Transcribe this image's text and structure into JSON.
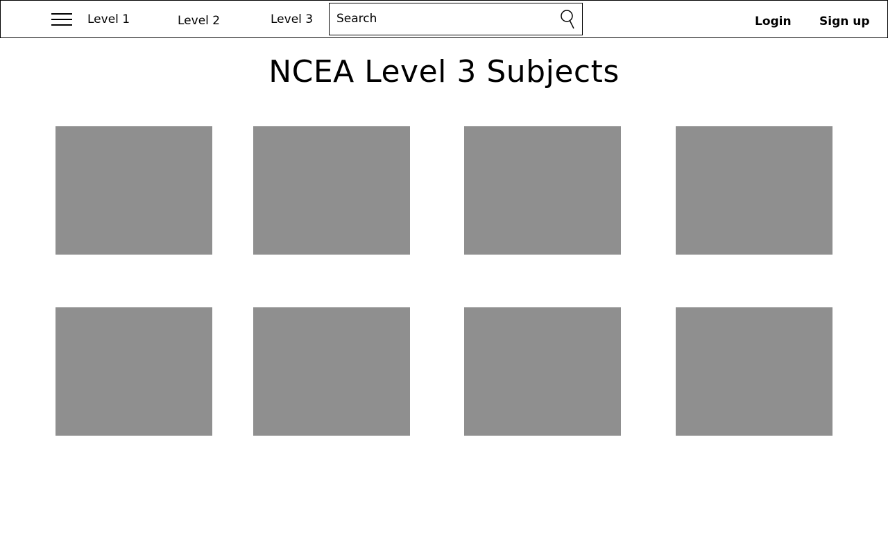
{
  "nav": {
    "menu_icon": "hamburger-menu-icon",
    "links": [
      "Level 1",
      "Level 2",
      "Level 3"
    ],
    "search": {
      "placeholder": "Search",
      "icon": "search-icon"
    },
    "login_label": "Login",
    "signup_label": "Sign up"
  },
  "main": {
    "title": "NCEA Level 3 Subjects"
  },
  "colors": {
    "tile_placeholder": "#8f8f8f",
    "border": "#000000",
    "background": "#ffffff"
  }
}
